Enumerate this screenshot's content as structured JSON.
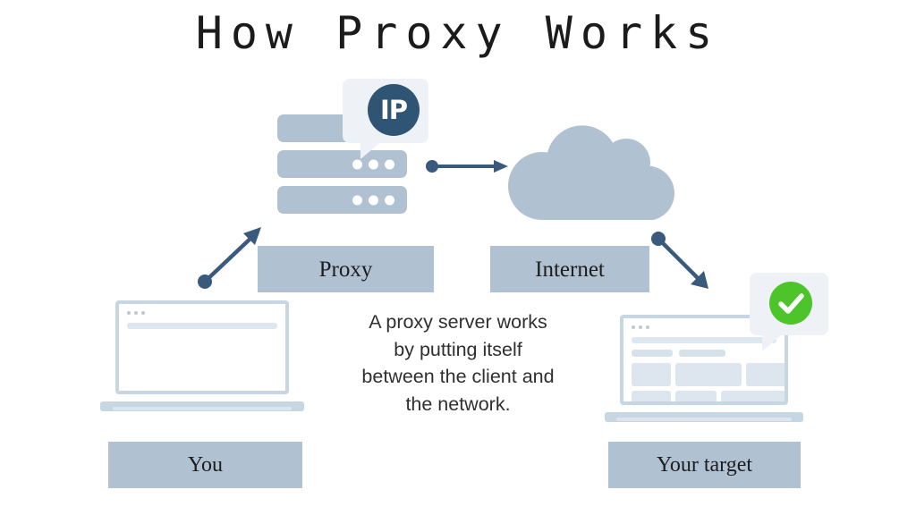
{
  "page": {
    "title": "How Proxy Works",
    "background_color": "#ffffff"
  },
  "colors": {
    "accent_blue_gray": "#b0c1d1",
    "arrow_navy": "#3a5a7d",
    "ip_badge_circle": "#2f5474",
    "bubble_background": "#eef2f6",
    "check_green": "#4cc42a",
    "laptop_outline": "#c7d6e3",
    "title_text": "#1b1b1b",
    "body_text": "#2f2f2f"
  },
  "nodes": {
    "proxy_label": "Proxy",
    "internet_label": "Internet",
    "you_label": "You",
    "target_label": "Your target"
  },
  "ip_badge": {
    "text": "IP"
  },
  "description": {
    "lines": [
      "A proxy server works",
      "by putting itself",
      "between the client and",
      "the network."
    ],
    "full_text": "A proxy server works by putting itself between the client and the network."
  },
  "icons": {
    "server": "server-stack-icon",
    "cloud": "cloud-icon",
    "ip_badge": "ip-badge-icon",
    "check": "check-circle-icon",
    "laptop_client": "laptop-client-icon",
    "laptop_target": "laptop-target-icon",
    "arrow_proxy_to_internet": "arrow-right-icon",
    "arrow_you_to_proxy": "arrow-up-right-icon",
    "arrow_internet_to_target": "arrow-down-right-icon"
  }
}
